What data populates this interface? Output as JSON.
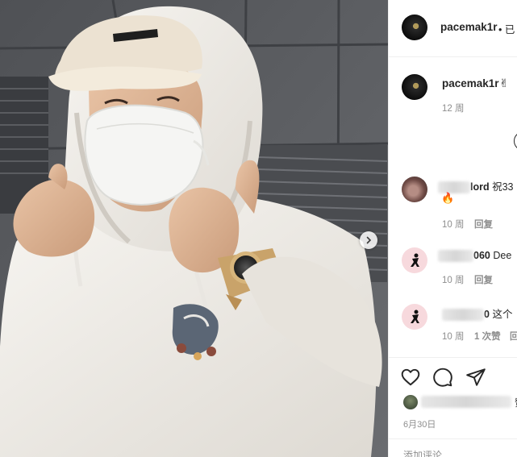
{
  "post": {
    "username": "pacemak1r",
    "header_suffix": "• 已",
    "caption_emoji": "✌",
    "caption_time": "12 周",
    "date": "6月30日"
  },
  "comments": [
    {
      "user_visible": "lord",
      "text": "祝33",
      "emoji": "🔥",
      "time": "10 周",
      "reply": "回复",
      "likes": ""
    },
    {
      "user_visible": "060",
      "text": "Dee",
      "emoji": "",
      "time": "10 周",
      "reply": "回复",
      "likes": ""
    },
    {
      "user_visible": "0",
      "text": "这个",
      "emoji": "",
      "time": "10 周",
      "reply": "回",
      "likes": "1 次赞"
    }
  ],
  "actions": {
    "like_icon": "heart-icon",
    "comment_icon": "comment-bubble-icon",
    "share_icon": "paper-plane-icon",
    "likes_suffix": "赞"
  },
  "footer": {
    "add_comment": "添加评论..."
  },
  "colors": {
    "text": "#262626",
    "muted": "#8e8e8e",
    "divider": "#efefef",
    "hoodie": "#eeebe6",
    "watch_gold": "#c9a36a"
  }
}
